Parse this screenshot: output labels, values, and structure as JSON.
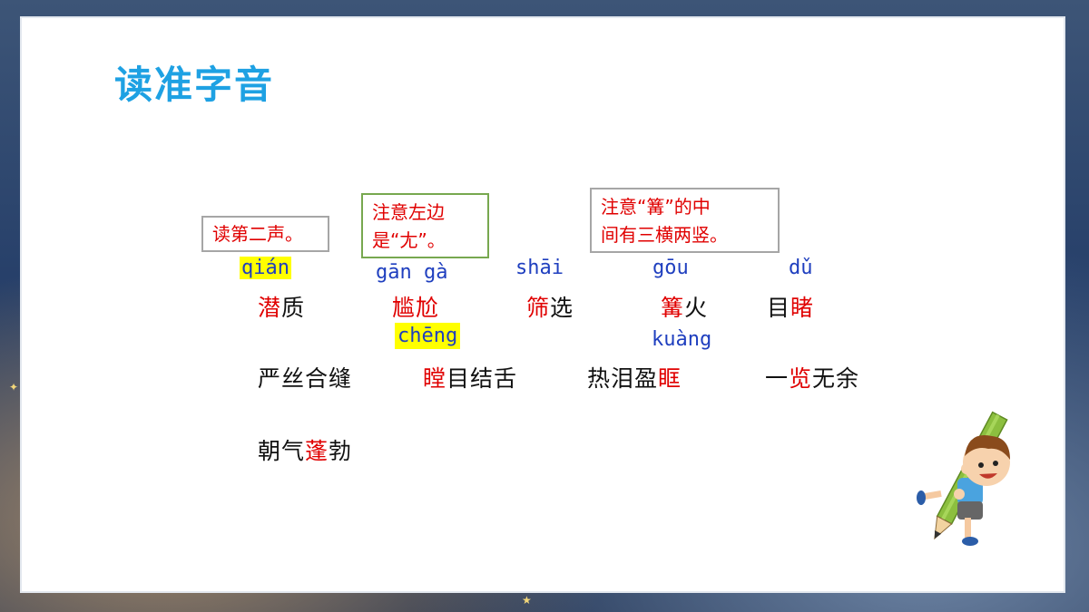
{
  "title": "读准字音",
  "notes": {
    "n1": "读第二声。",
    "n2_l1": "注意左边",
    "n2_l2": "是“尢”。",
    "n3_l1": "注意“篝”的中",
    "n3_l2": "间有三横两竖。"
  },
  "pinyin": {
    "qian": "qián",
    "ganga": "gān gà",
    "shai": "shāi",
    "gou": "gōu",
    "du": "dǔ",
    "cheng": "chēng",
    "kuang": "kuàng"
  },
  "row1": [
    {
      "hl": "潜",
      "rest": "质"
    },
    {
      "hl": "尴尬",
      "rest": ""
    },
    {
      "hl": "筛",
      "rest": "选"
    },
    {
      "hl": "篝",
      "rest": "火"
    },
    {
      "pre": "目",
      "hl": "睹"
    }
  ],
  "row2": [
    {
      "pre": "严丝合缝",
      "hl": "",
      "rest": ""
    },
    {
      "pre": "",
      "hl": "瞠",
      "rest": "目结舌"
    },
    {
      "pre": "热泪盈",
      "hl": "眶",
      "rest": ""
    },
    {
      "pre": "一",
      "hl": "览",
      "rest": "无余"
    }
  ],
  "row3": [
    {
      "pre": "朝气",
      "hl": "蓬",
      "rest": "勃"
    }
  ],
  "colors": {
    "accent": "#1ea1e3",
    "highlight": "#e00000",
    "pinyin": "#1f3fbf",
    "marker": "#ffff00"
  }
}
